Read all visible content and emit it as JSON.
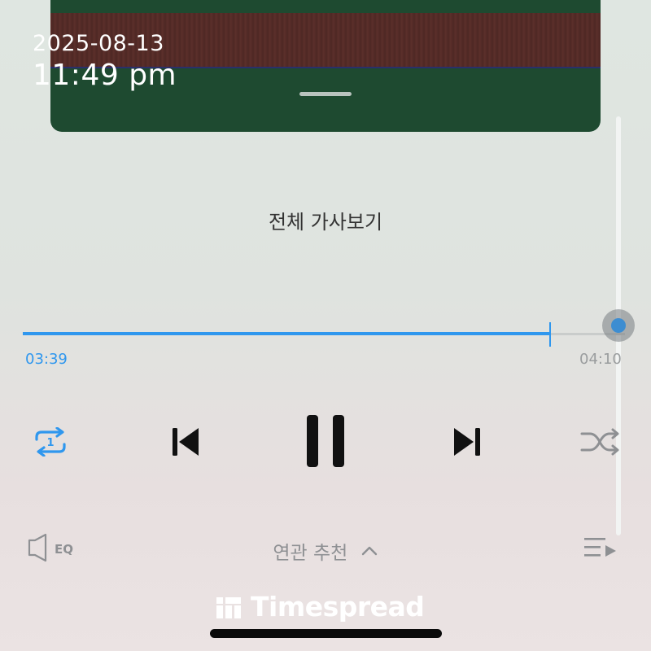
{
  "overlay": {
    "date": "2025-08-13",
    "time": "11:49 pm"
  },
  "lyrics": {
    "full_lyrics_label": "전체 가사보기"
  },
  "playback": {
    "current_time": "03:39",
    "total_time": "04:10",
    "progress_fraction": 0.876,
    "accent_color": "#2f97ee"
  },
  "controls": {
    "repeat_icon": "repeat-one-icon",
    "repeat_badge": "1",
    "previous_icon": "skip-previous-icon",
    "pause_icon": "pause-icon",
    "next_icon": "skip-next-icon",
    "shuffle_icon": "shuffle-icon"
  },
  "bottom_bar": {
    "eq_label": "EQ",
    "related_label": "연관 추천",
    "playlist_icon": "playlist-icon"
  },
  "watermark": {
    "text": "Timespread"
  }
}
